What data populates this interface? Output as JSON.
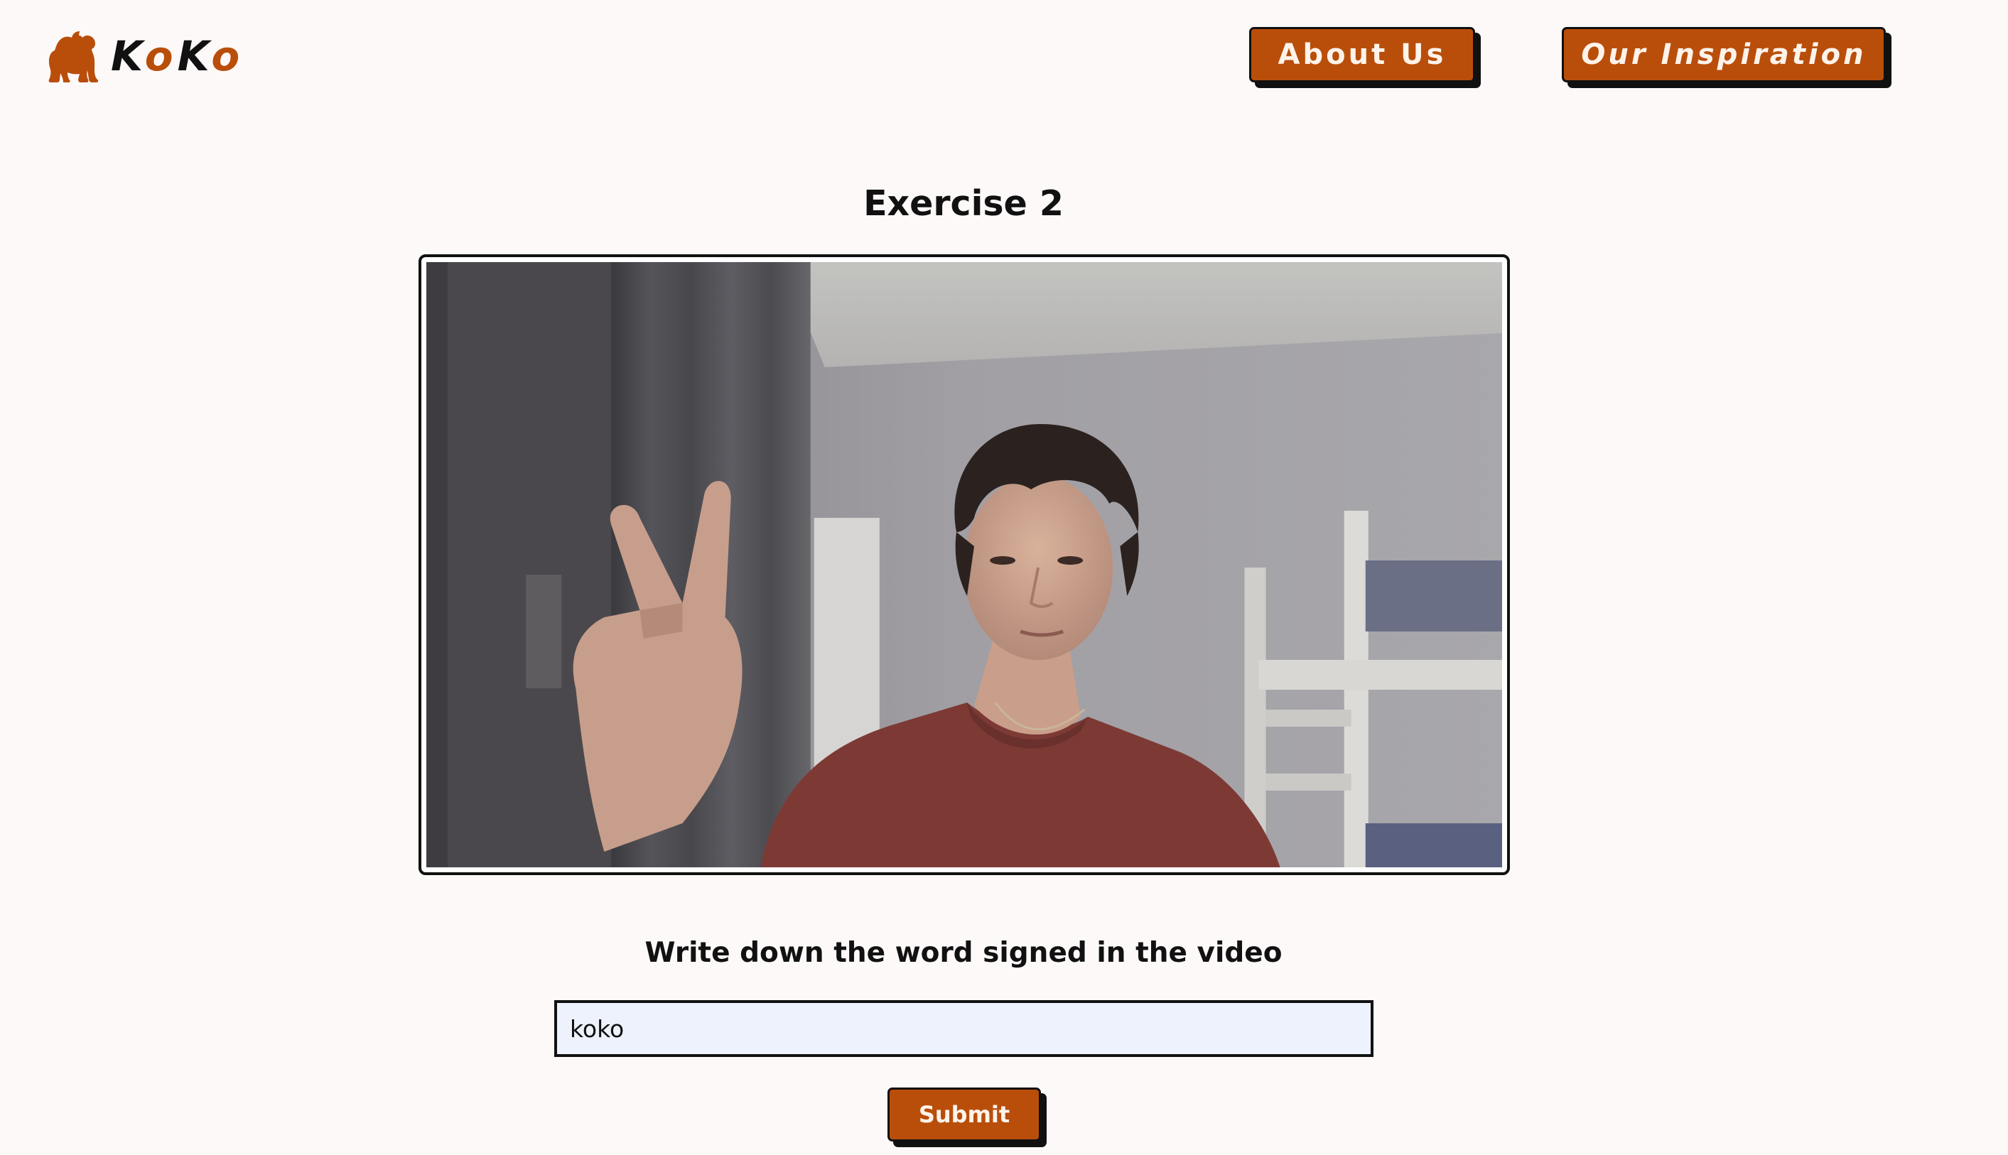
{
  "brand": {
    "logo_icon": "gorilla-icon",
    "name_part_1": "K",
    "name_part_2": "o",
    "name_part_3": "K",
    "name_part_4": "o"
  },
  "nav": {
    "about_label": "About Us",
    "inspiration_label": "Our Inspiration"
  },
  "exercise": {
    "title": "Exercise 2",
    "prompt": "Write down the word signed in the video",
    "answer_value": "koko",
    "submit_label": "Submit"
  },
  "colors": {
    "accent": "#b94e0b",
    "background": "#fdf9f8",
    "input_background": "#eef2fc",
    "border": "#111111"
  }
}
